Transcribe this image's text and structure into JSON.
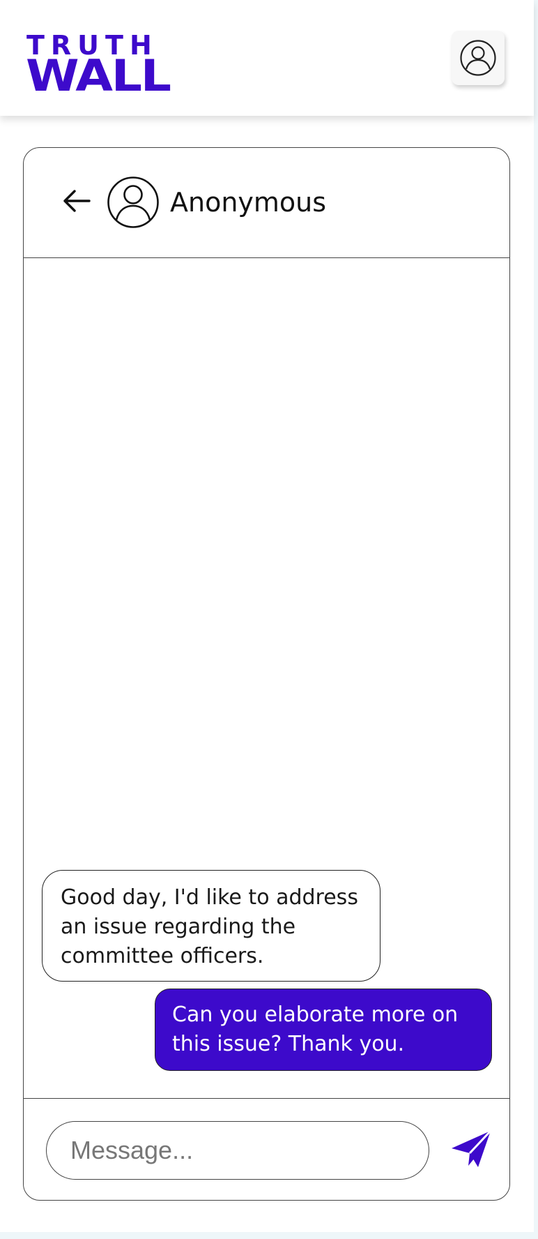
{
  "header": {
    "logo_top": "TRUTH",
    "logo_bottom": "WALL",
    "profile_icon": "user-circle-icon"
  },
  "chat": {
    "back_icon": "arrow-left-icon",
    "avatar_icon": "user-circle-icon",
    "contact_name": "Anonymous",
    "messages": [
      {
        "direction": "incoming",
        "text": "Good day, I'd like to address an issue regarding the committee officers."
      },
      {
        "direction": "outgoing",
        "text": "Can you elaborate more on this issue? Thank you."
      }
    ]
  },
  "composer": {
    "placeholder": "Message...",
    "value": "",
    "send_icon": "paper-plane-icon"
  },
  "colors": {
    "brand": "#3d0acb",
    "background": "#ffffff",
    "page_edge": "#eef6f9"
  }
}
